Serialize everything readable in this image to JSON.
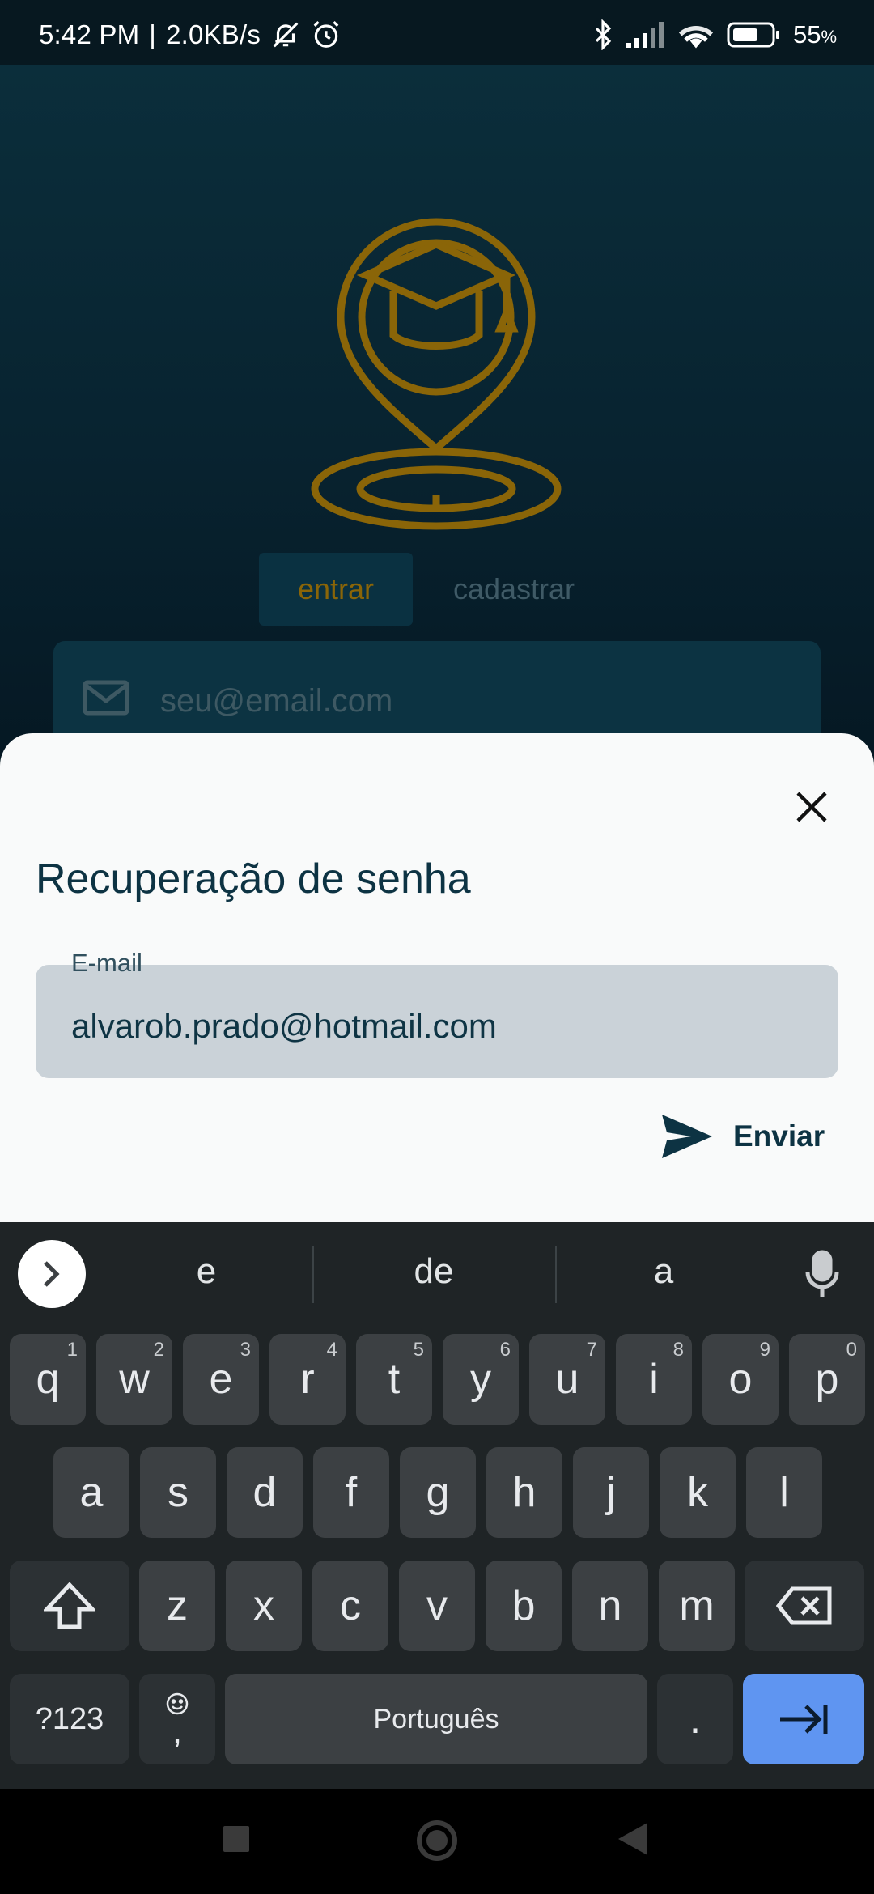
{
  "status_bar": {
    "time": "5:42 PM",
    "separator": "|",
    "speed": "2.0KB/s",
    "battery": "55",
    "battery_unit": "%",
    "icons": [
      "mute-icon",
      "alarm-icon",
      "bluetooth-icon",
      "signal-icon",
      "wifi-icon",
      "battery-icon"
    ]
  },
  "background": {
    "tabs": [
      {
        "label": "entrar",
        "active": true
      },
      {
        "label": "cadastrar",
        "active": false
      }
    ],
    "email_placeholder": "seu@email.com",
    "accent": "#8a6508"
  },
  "dialog": {
    "title": "Recuperação de senha",
    "field_label": "E-mail",
    "field_value": "alvarob.prado@hotmail.com",
    "send_label": "Enviar",
    "text_color": "#0d3343"
  },
  "keyboard": {
    "suggestions": [
      "e",
      "de",
      "a"
    ],
    "row1": [
      {
        "k": "q",
        "n": "1"
      },
      {
        "k": "w",
        "n": "2"
      },
      {
        "k": "e",
        "n": "3"
      },
      {
        "k": "r",
        "n": "4"
      },
      {
        "k": "t",
        "n": "5"
      },
      {
        "k": "y",
        "n": "6"
      },
      {
        "k": "u",
        "n": "7"
      },
      {
        "k": "i",
        "n": "8"
      },
      {
        "k": "o",
        "n": "9"
      },
      {
        "k": "p",
        "n": "0"
      }
    ],
    "row2": [
      "a",
      "s",
      "d",
      "f",
      "g",
      "h",
      "j",
      "k",
      "l"
    ],
    "row3": [
      "z",
      "x",
      "c",
      "v",
      "b",
      "n",
      "m"
    ],
    "symbols_label": "?123",
    "comma_label": ",",
    "space_label": "Português",
    "period_label": ".",
    "enter_color": "#5f95f1"
  }
}
